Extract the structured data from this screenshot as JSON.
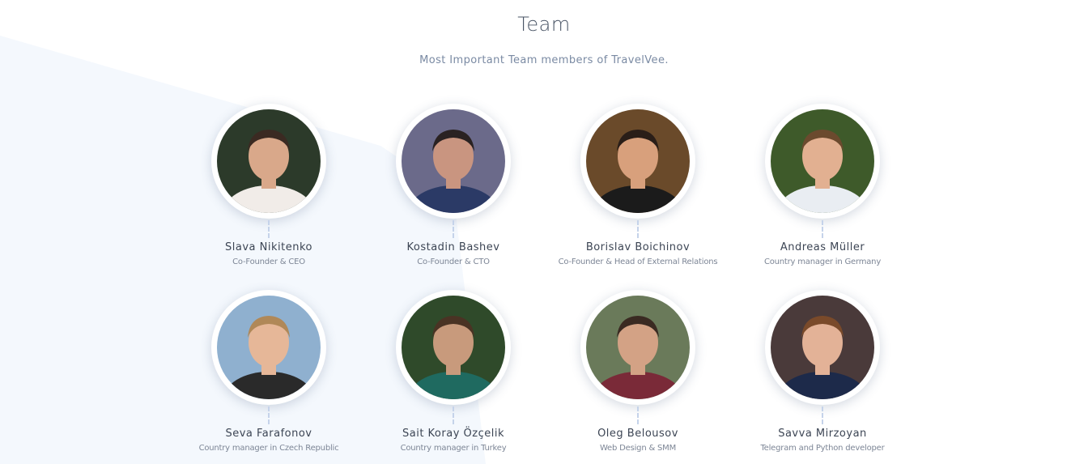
{
  "section": {
    "title": "Team",
    "subtitle": "Most Important Team members of TravelVee."
  },
  "members": [
    {
      "name": "Slava Nikitenko",
      "role": "Co-Founder & CEO",
      "photo_bg": "#2c3a2a",
      "skin": "#d9a88a",
      "shirt": "#f1ece8",
      "hair": "#3b2a22"
    },
    {
      "name": "Kostadin Bashev",
      "role": "Co-Founder & CTO",
      "photo_bg": "#6b6a8a",
      "skin": "#c99580",
      "shirt": "#2b3a66",
      "hair": "#2a2222"
    },
    {
      "name": "Borislav Boichinov",
      "role": "Co-Founder & Head of External Relations",
      "photo_bg": "#6a4a2a",
      "skin": "#d8a07c",
      "shirt": "#1b1b1b",
      "hair": "#2a1e18"
    },
    {
      "name": "Andreas Müller",
      "role": "Country manager in Germany",
      "photo_bg": "#3e5a2a",
      "skin": "#e2b091",
      "shirt": "#e9edf2",
      "hair": "#6b4a2e"
    },
    {
      "name": "Seva Farafonov",
      "role": "Country manager in Czech Republic",
      "photo_bg": "#8fb0cf",
      "skin": "#e6b798",
      "shirt": "#2a2a2a",
      "hair": "#b08858"
    },
    {
      "name": "Sait Koray Özçelik",
      "role": "Country manager in Turkey",
      "photo_bg": "#2f4a2a",
      "skin": "#c89a7c",
      "shirt": "#1f6a60",
      "hair": "#4a3324"
    },
    {
      "name": "Oleg Belousov",
      "role": "Web Design & SMM",
      "photo_bg": "#6a7a5a",
      "skin": "#d3a285",
      "shirt": "#7a2a38",
      "hair": "#3a2a22"
    },
    {
      "name": "Savva Mirzoyan",
      "role": "Telegram and Python developer",
      "photo_bg": "#4a3a3a",
      "skin": "#e3b297",
      "shirt": "#1d2a4a",
      "hair": "#7a4a2a"
    }
  ],
  "colors": {
    "title": "#4a5566",
    "subtitle": "#7a8aa3",
    "name": "#3c4554",
    "role": "#7d8696",
    "connector": "#c5d3ea",
    "background_shape": "#f4f8fd"
  }
}
